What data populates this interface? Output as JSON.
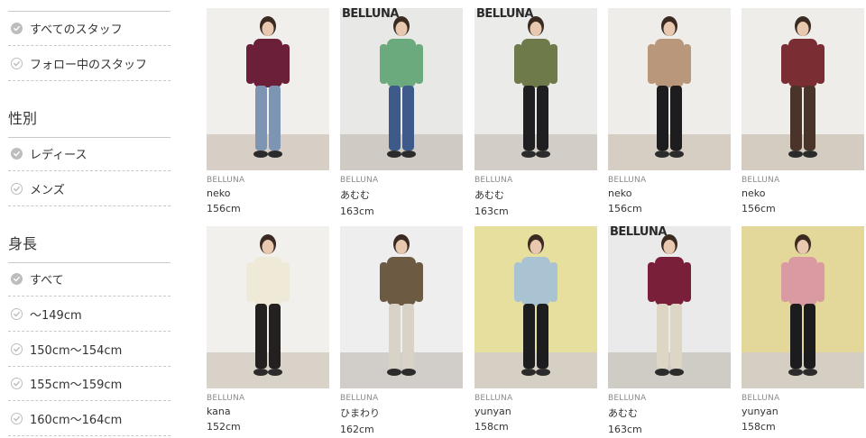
{
  "sidebar": {
    "staff_filter": [
      {
        "label": "すべてのスタッフ",
        "state": "selected"
      },
      {
        "label": "フォロー中のスタッフ",
        "state": "unselected"
      }
    ],
    "gender": {
      "heading": "性別",
      "items": [
        {
          "label": "レディース",
          "state": "selected"
        },
        {
          "label": "メンズ",
          "state": "unselected"
        }
      ]
    },
    "height": {
      "heading": "身長",
      "items": [
        {
          "label": "すべて",
          "state": "selected"
        },
        {
          "label": "～149cm",
          "state": "unselected"
        },
        {
          "label": "150cm～154cm",
          "state": "unselected"
        },
        {
          "label": "155cm～159cm",
          "state": "unselected"
        },
        {
          "label": "160cm～164cm",
          "state": "unselected"
        }
      ]
    }
  },
  "grid": {
    "cards": [
      {
        "brand": "BELLUNA",
        "name": "neko",
        "height": "156cm",
        "wall": "#f1efec",
        "floor": "#d7cfc5",
        "top": "#6b1f38",
        "bottom": "#7d94b3",
        "wall_text": ""
      },
      {
        "brand": "BELLUNA",
        "name": "あむむ",
        "height": "163cm",
        "wall": "#e8e8e6",
        "floor": "#cfcac3",
        "top": "#6aaa7c",
        "bottom": "#3e5a8a",
        "wall_text": "BELLUNA"
      },
      {
        "brand": "BELLUNA",
        "name": "あむむ",
        "height": "163cm",
        "wall": "#ebebea",
        "floor": "#d2cdc6",
        "top": "#6f7a4a",
        "bottom": "#1f1f22",
        "wall_text": "BELLUNA"
      },
      {
        "brand": "BELLUNA",
        "name": "neko",
        "height": "156cm",
        "wall": "#efede9",
        "floor": "#d6cec3",
        "top": "#b8977a",
        "bottom": "#1d1d20",
        "wall_text": ""
      },
      {
        "brand": "BELLUNA",
        "name": "neko",
        "height": "156cm",
        "wall": "#efedea",
        "floor": "#d4ccc1",
        "top": "#7a2d33",
        "bottom": "#4a3429",
        "wall_text": ""
      },
      {
        "brand": "BELLUNA",
        "name": "kana",
        "height": "152cm",
        "wall": "#f2f0ed",
        "floor": "#d9d2c8",
        "top": "#efe9d8",
        "bottom": "#24201f",
        "wall_text": ""
      },
      {
        "brand": "BELLUNA",
        "name": "ひまわり",
        "height": "162cm",
        "wall": "#eeeeee",
        "floor": "#d1cdc8",
        "top": "#6d5a43",
        "bottom": "#d9d3c7",
        "wall_text": ""
      },
      {
        "brand": "BELLUNA",
        "name": "yunyan",
        "height": "158cm",
        "wall": "#e6df9e",
        "floor": "#d6cfc4",
        "top": "#a9c3d2",
        "bottom": "#1d1d1f",
        "wall_text": ""
      },
      {
        "brand": "BELLUNA",
        "name": "あむむ",
        "height": "163cm",
        "wall": "#eaeaea",
        "floor": "#cfcbc5",
        "top": "#7a1f3a",
        "bottom": "#ddd6c5",
        "wall_text": "BELLUNA"
      },
      {
        "brand": "BELLUNA",
        "name": "yunyan",
        "height": "158cm",
        "wall": "#e3d79a",
        "floor": "#d5cec3",
        "top": "#d99aa2",
        "bottom": "#1c1c1e",
        "wall_text": ""
      }
    ]
  },
  "colors": {
    "divider": "#c8c8c8",
    "check": "#bdbdbd",
    "brand_text": "#8a8a8a"
  }
}
